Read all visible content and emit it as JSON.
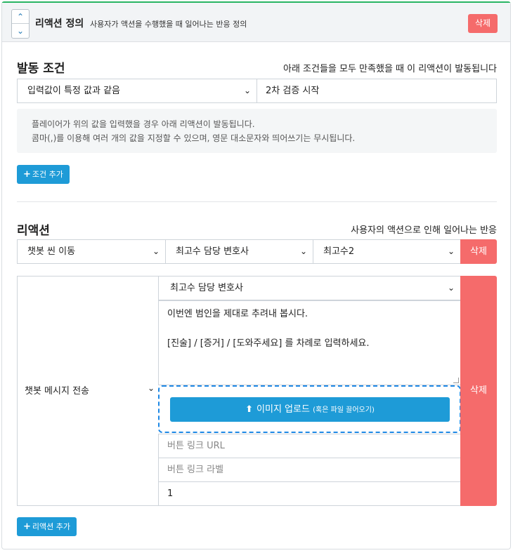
{
  "header": {
    "title": "리액션 정의",
    "subtitle": "사용자가 액션을 수행했을 때 일어나는 반응 정의",
    "delete_label": "삭제"
  },
  "trigger": {
    "title": "발동 조건",
    "note": "아래 조건들을 모두 만족했을 때 이 리액션이 발동됩니다",
    "condition_select": "입력값이 특정 값과 같음",
    "condition_value": "2차 검증 시작",
    "info_line1": "플레이어가 위의 값을 입력했을 경우 아래 리액션이 발동됩니다.",
    "info_line2": "콤마(,)를 이용해 여러 개의 값을 지정할 수 있으며, 영문 대소문자와 띄어쓰기는 무시됩니다.",
    "add_condition_label": "조건 추가"
  },
  "actions": {
    "title": "리액션",
    "note": "사용자의 액션으로 인해 일어나는 반응",
    "row1": {
      "type": "챗봇 씬 이동",
      "target": "최고수 담당 변호사",
      "scene": "최고수2",
      "delete_label": "삭제"
    },
    "row2": {
      "type": "챗봇 메시지 전송",
      "speaker": "최고수 담당 변호사",
      "message_line1": "이번엔 범인을 제대로 추려내 봅시다.",
      "message_line2": "[진술] / [증거] / [도와주세요] 를 차례로 입력하세요.",
      "upload_label": "이미지 업로드",
      "upload_hint": "(혹은 파일 끌어오기)",
      "button_url_placeholder": "버튼 링크 URL",
      "button_label_placeholder": "버튼 링크 라벨",
      "delay_value": "1",
      "delete_label": "삭제"
    },
    "add_action_label": "리액션 추가"
  },
  "colors": {
    "accent": "#1e9bd7",
    "danger": "#f56b6b",
    "header_top_border": "#28b463"
  },
  "icons": [
    "chevron-up-icon",
    "chevron-down-icon",
    "plus-icon",
    "upload-icon"
  ]
}
